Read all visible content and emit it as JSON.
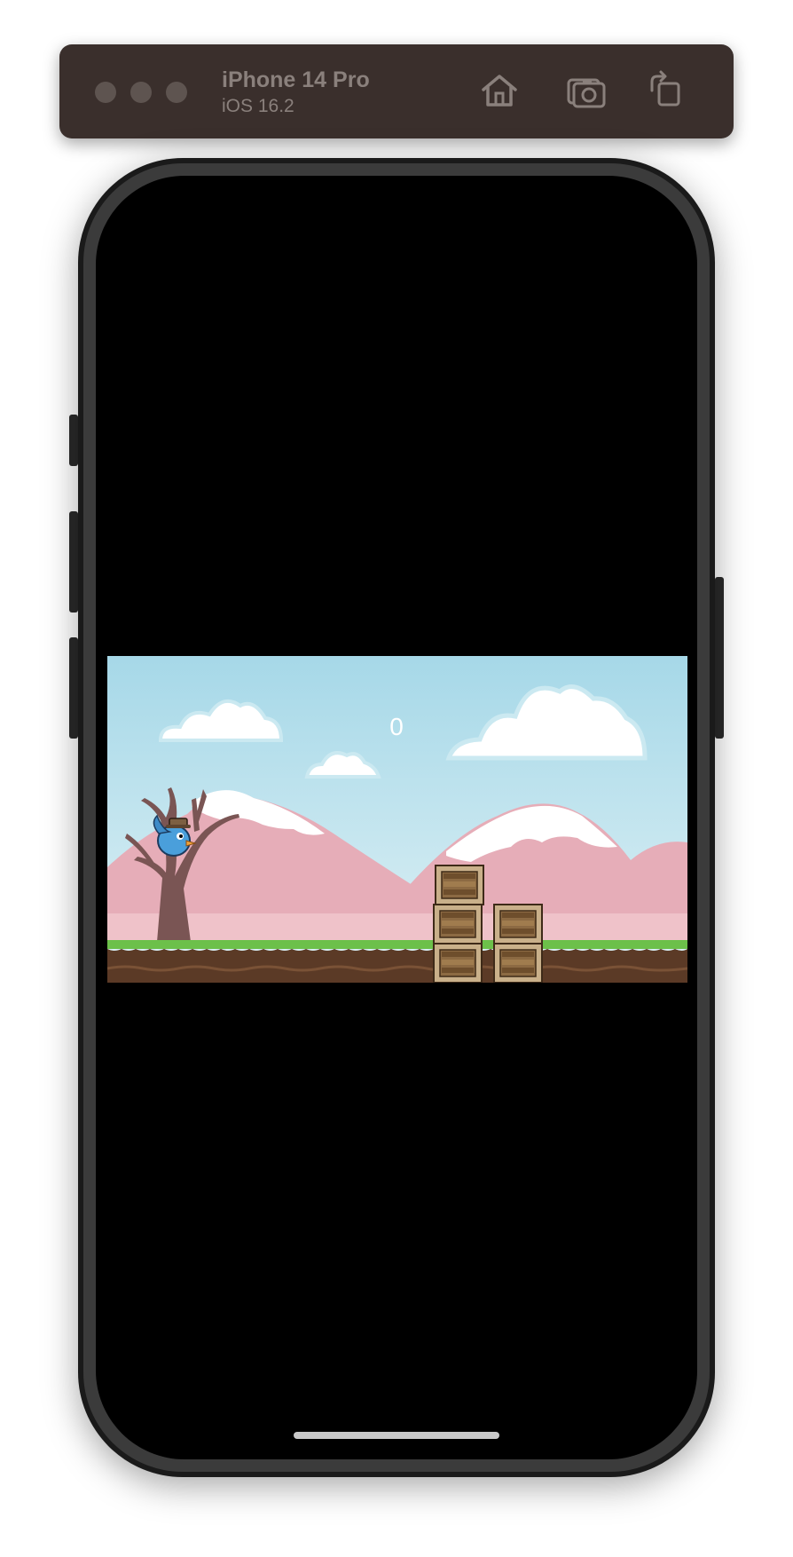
{
  "toolbar": {
    "device_name": "iPhone 14 Pro",
    "os_version": "iOS 16.2",
    "buttons": [
      {
        "name": "home",
        "icon": "home-icon"
      },
      {
        "name": "screenshot",
        "icon": "camera-icon"
      },
      {
        "name": "rotate",
        "icon": "rotate-icon"
      }
    ]
  },
  "game": {
    "score": "0",
    "sky_color": "#a6d8e8",
    "mountain_color": "#e6adb8",
    "snow_color": "#ffffff",
    "grass_color": "#6cc04a",
    "dirt_color": "#5b3a26",
    "crate_color": "#8c6a43"
  }
}
